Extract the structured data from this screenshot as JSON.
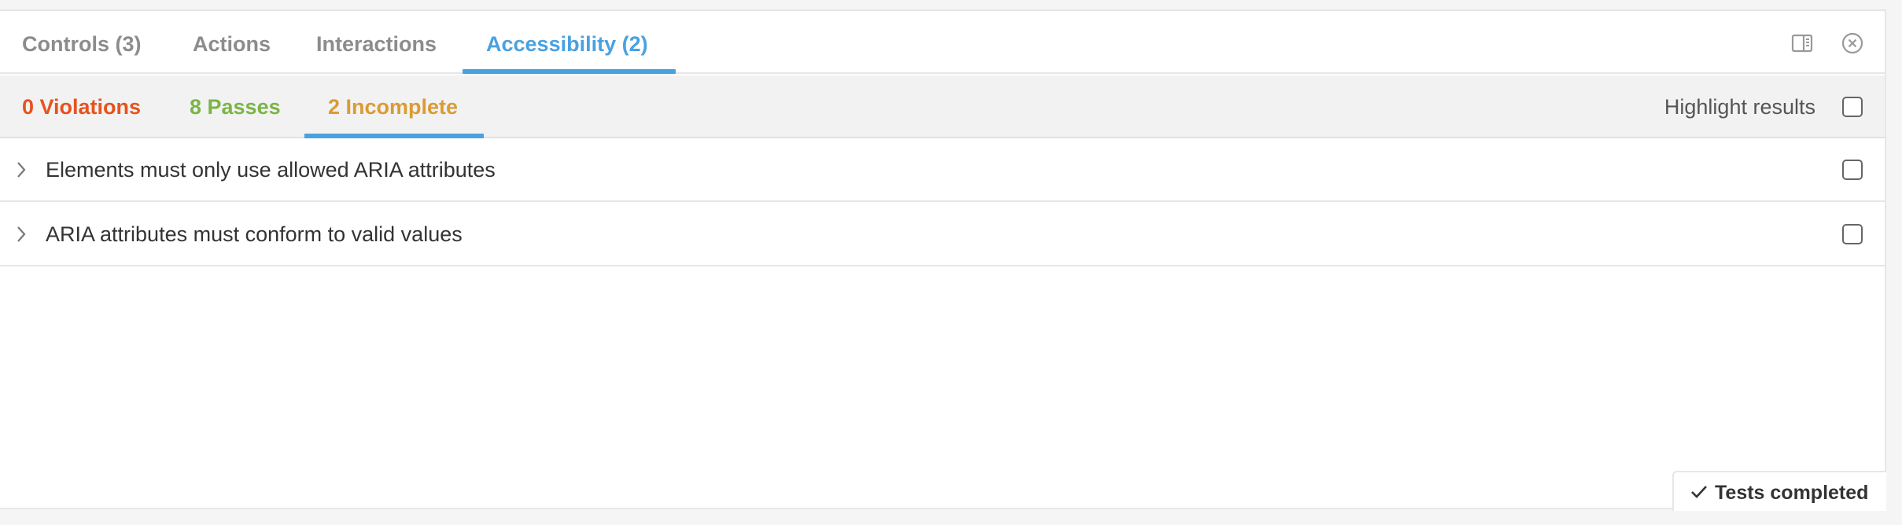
{
  "tabs": [
    {
      "label": "Controls (3)",
      "active": false
    },
    {
      "label": "Actions",
      "active": false
    },
    {
      "label": "Interactions",
      "active": false
    },
    {
      "label": "Accessibility (2)",
      "active": true
    }
  ],
  "toolbar_icons": {
    "panel_toggle": "panel-orientation-icon",
    "close": "close-circle-icon"
  },
  "subtabs": [
    {
      "label": "0 Violations",
      "color": "#e6531d",
      "active": false
    },
    {
      "label": "8 Passes",
      "color": "#7ab545",
      "active": false
    },
    {
      "label": "2 Incomplete",
      "color": "#db9b32",
      "active": true
    }
  ],
  "highlight": {
    "label": "Highlight results",
    "checked": false
  },
  "rules": [
    {
      "label": "Elements must only use allowed ARIA attributes",
      "checked": false
    },
    {
      "label": "ARIA attributes must conform to valid values",
      "checked": false
    }
  ],
  "status": {
    "label": "Tests completed",
    "icon": "check-icon"
  },
  "colors": {
    "accent": "#4aa1e0",
    "tab_inactive": "#8c8c8c"
  }
}
